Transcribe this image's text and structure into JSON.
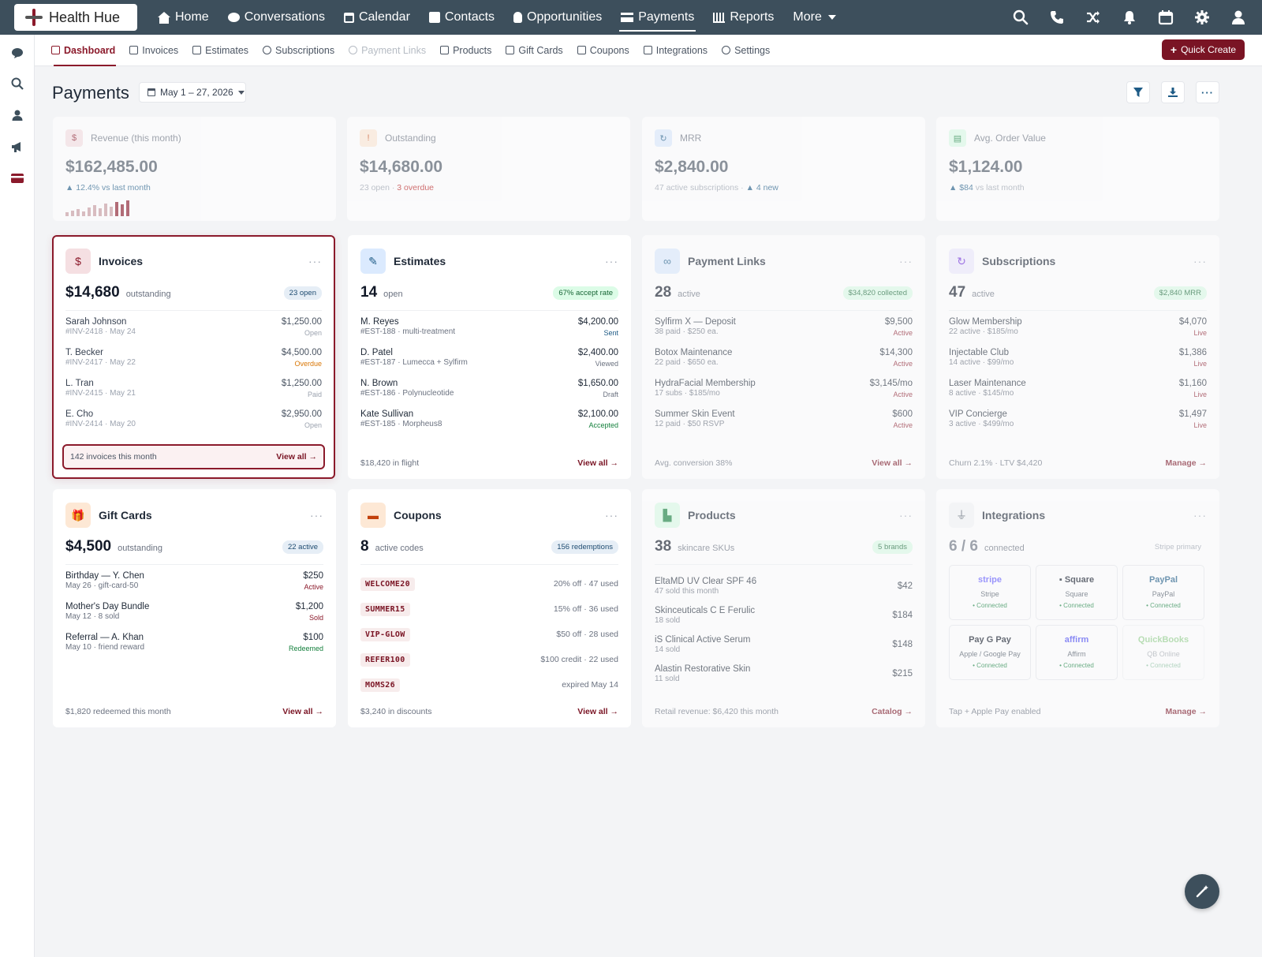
{
  "brand": {
    "name": "Health Hue"
  },
  "topnav": {
    "items": [
      {
        "label": "Home",
        "icon": "home-icon"
      },
      {
        "label": "Conversations",
        "icon": "chat-icon"
      },
      {
        "label": "Calendar",
        "icon": "calendar-icon"
      },
      {
        "label": "Contacts",
        "icon": "contacts-icon"
      },
      {
        "label": "Opportunities",
        "icon": "lightbulb-icon"
      },
      {
        "label": "Payments",
        "icon": "payment-icon"
      },
      {
        "label": "Reports",
        "icon": "chart-icon"
      },
      {
        "label": "More",
        "icon": "chevron-down-icon"
      }
    ],
    "active": "Payments"
  },
  "subnav": {
    "items": [
      {
        "label": "Dashboard"
      },
      {
        "label": "Invoices"
      },
      {
        "label": "Estimates"
      },
      {
        "label": "Subscriptions"
      },
      {
        "label": "Payment Links"
      },
      {
        "label": "Products"
      },
      {
        "label": "Gift Cards"
      },
      {
        "label": "Coupons"
      },
      {
        "label": "Integrations"
      },
      {
        "label": "Settings"
      }
    ],
    "quick_create": "Quick Create"
  },
  "page": {
    "title": "Payments",
    "date_range": "May 1 – 27, 2026"
  },
  "colors": {
    "accent": "#8b1a2b",
    "topbar": "#3d4f5c",
    "success": "#15803d",
    "warning": "#d97706"
  },
  "stats": [
    {
      "label": "Revenue (this month)",
      "value": "$162,485.00",
      "sub": "▲ 12.4% vs last month",
      "spark": [
        5,
        7,
        9,
        6,
        11,
        14,
        10,
        16,
        12,
        18,
        15,
        20
      ]
    },
    {
      "label": "Outstanding",
      "value": "$14,680.00",
      "sub": "23 open · ",
      "sub_alert": "3 overdue"
    },
    {
      "label": "MRR",
      "value": "$2,840.00",
      "sub": "47 active subscriptions · ",
      "sub_good": "▲ 4 new"
    },
    {
      "label": "Avg. Order Value",
      "value": "$1,124.00",
      "sub_good": "▲ $84",
      "sub": " vs last month"
    }
  ],
  "invoices": {
    "title": "Invoices",
    "amount": "$14,680",
    "amount_label": "outstanding",
    "pill": "23 open",
    "rows": [
      {
        "name": "Sarah Johnson",
        "meta": "#INV-2418 · May 24",
        "value": "$1,250.00",
        "status": "Open"
      },
      {
        "name": "T. Becker",
        "meta": "#INV-2417 · May 22",
        "value": "$4,500.00",
        "status": "Overdue"
      },
      {
        "name": "L. Tran",
        "meta": "#INV-2415 · May 21",
        "value": "$1,250.00",
        "status": "Paid"
      },
      {
        "name": "E. Cho",
        "meta": "#INV-2414 · May 20",
        "value": "$2,950.00",
        "status": "Open"
      }
    ],
    "foot": "142 invoices this month",
    "foot_link": "View all →"
  },
  "estimates": {
    "title": "Estimates",
    "amount": "14",
    "amount_label": "open",
    "pill": "67% accept rate",
    "rows": [
      {
        "name": "M. Reyes",
        "meta": "#EST-188 · multi-treatment",
        "value": "$4,200.00",
        "status": "Sent"
      },
      {
        "name": "D. Patel",
        "meta": "#EST-187 · Lumecca + Sylfirm",
        "value": "$2,400.00",
        "status": "Viewed"
      },
      {
        "name": "N. Brown",
        "meta": "#EST-186 · Polynucleotide",
        "value": "$1,650.00",
        "status": "Draft"
      },
      {
        "name": "Kate Sullivan",
        "meta": "#EST-185 · Morpheus8",
        "value": "$2,100.00",
        "status": "Accepted"
      }
    ],
    "foot": "$18,420 in flight",
    "foot_link": "View all →"
  },
  "payment_links": {
    "title": "Payment Links",
    "amount": "28",
    "amount_label": "active",
    "pill": "$34,820 collected",
    "rows": [
      {
        "name": "Sylfirm X — Deposit",
        "meta": "38 paid · $250 ea.",
        "value": "$9,500",
        "status": "Active"
      },
      {
        "name": "Botox Maintenance",
        "meta": "22 paid · $650 ea.",
        "value": "$14,300",
        "status": "Active"
      },
      {
        "name": "HydraFacial Membership",
        "meta": "17 subs · $185/mo",
        "value": "$3,145/mo",
        "status": "Active"
      },
      {
        "name": "Summer Skin Event",
        "meta": "12 paid · $50 RSVP",
        "value": "$600",
        "status": "Active"
      }
    ],
    "foot": "Avg. conversion 38%",
    "foot_link": "View all →"
  },
  "subscriptions": {
    "title": "Subscriptions",
    "amount": "47",
    "amount_label": "active",
    "pill": "$2,840 MRR",
    "rows": [
      {
        "name": "Glow Membership",
        "meta": "22 active · $185/mo",
        "value": "$4,070",
        "status": "Live"
      },
      {
        "name": "Injectable Club",
        "meta": "14 active · $99/mo",
        "value": "$1,386",
        "status": "Live"
      },
      {
        "name": "Laser Maintenance",
        "meta": "8 active · $145/mo",
        "value": "$1,160",
        "status": "Live"
      },
      {
        "name": "VIP Concierge",
        "meta": "3 active · $499/mo",
        "value": "$1,497",
        "status": "Live"
      }
    ],
    "foot": "Churn 2.1% · LTV $4,420",
    "foot_link": "Manage →"
  },
  "gift_cards": {
    "title": "Gift Cards",
    "amount": "$4,500",
    "amount_label": "outstanding",
    "pill": "22 active",
    "rows": [
      {
        "name": "Birthday — Y. Chen",
        "meta": "May 26 · gift-card-50",
        "value": "$250",
        "status": "Active"
      },
      {
        "name": "Mother's Day Bundle",
        "meta": "May 12 · 8 sold",
        "value": "$1,200",
        "status": "Sold"
      },
      {
        "name": "Referral — A. Khan",
        "meta": "May 10 · friend reward",
        "value": "$100",
        "status": "Redeemed"
      }
    ],
    "foot": "$1,820 redeemed this month",
    "foot_link": "View all →"
  },
  "coupons": {
    "title": "Coupons",
    "amount": "8",
    "amount_label": "active codes",
    "pill": "156 redemptions",
    "rows": [
      {
        "code": "WELCOME20",
        "info": "20% off · 47 used"
      },
      {
        "code": "SUMMER15",
        "info": "15% off · 36 used"
      },
      {
        "code": "VIP-GLOW",
        "info": "$50 off · 28 used"
      },
      {
        "code": "REFER100",
        "info": "$100 credit · 22 used"
      },
      {
        "code": "MOMS26",
        "info": "expired May 14"
      }
    ],
    "foot": "$3,240 in discounts",
    "foot_link": "View all →"
  },
  "products": {
    "title": "Products",
    "amount": "38",
    "amount_label": "skincare SKUs",
    "pill": "5 brands",
    "rows": [
      {
        "name": "EltaMD UV Clear SPF 46",
        "meta": "47 sold this month",
        "value": "$42"
      },
      {
        "name": "Skinceuticals C E Ferulic",
        "meta": "18 sold",
        "value": "$184"
      },
      {
        "name": "iS Clinical Active Serum",
        "meta": "14 sold",
        "value": "$148"
      },
      {
        "name": "Alastin Restorative Skin",
        "meta": "11 sold",
        "value": "$215"
      }
    ],
    "foot": "Retail revenue: $6,420 this month",
    "foot_link": "Catalog →"
  },
  "integrations": {
    "title": "Integrations",
    "amount": "6 / 6",
    "amount_label": "connected",
    "pill": "Stripe primary",
    "tiles": [
      {
        "logo": "stripe",
        "name": "Stripe",
        "status": "• Connected"
      },
      {
        "logo": "▪ Square",
        "name": "Square",
        "status": "• Connected"
      },
      {
        "logo": "PayPal",
        "name": "PayPal",
        "status": "• Connected"
      },
      {
        "logo": " Pay  G Pay",
        "name": "Apple / Google Pay",
        "status": "• Connected"
      },
      {
        "logo": "affirm",
        "name": "Affirm",
        "status": "• Connected"
      },
      {
        "logo": "QuickBooks",
        "name": "QB Online",
        "status": "• Connected"
      }
    ],
    "foot": "Tap + Apple Pay enabled",
    "foot_link": "Manage →"
  }
}
